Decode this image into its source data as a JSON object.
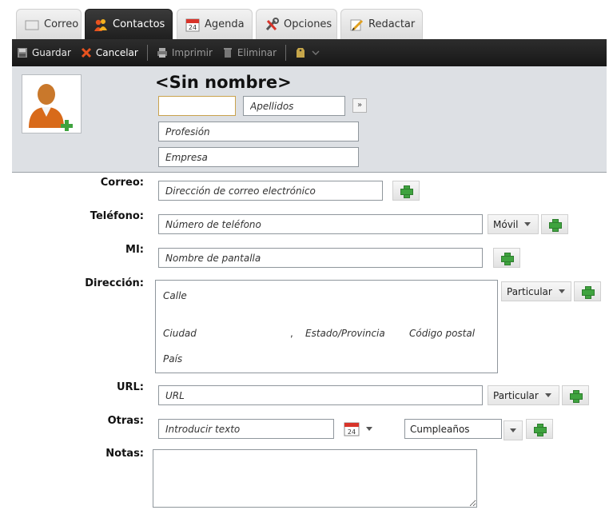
{
  "tabs": [
    {
      "label": "Correo",
      "icon": "mail-icon"
    },
    {
      "label": "Contactos",
      "icon": "contacts-icon"
    },
    {
      "label": "Agenda",
      "icon": "calendar-icon",
      "icon_text": "24"
    },
    {
      "label": "Opciones",
      "icon": "tools-icon"
    },
    {
      "label": "Redactar",
      "icon": "compose-icon"
    }
  ],
  "active_tab": "Contactos",
  "toolbar": {
    "save_label": "Guardar",
    "cancel_label": "Cancelar",
    "print_label": "Imprimir",
    "delete_label": "Eliminar"
  },
  "header": {
    "title": "<Sin nombre>",
    "first_name_value": "",
    "last_name_placeholder": "Apellidos",
    "expand_label": "»",
    "profession_placeholder": "Profesión",
    "company_placeholder": "Empresa"
  },
  "form": {
    "email": {
      "label": "Correo:",
      "placeholder": "Dirección de correo electrónico"
    },
    "phone": {
      "label": "Teléfono:",
      "placeholder": "Número de teléfono",
      "type": "Móvil"
    },
    "im": {
      "label": "MI:",
      "placeholder": "Nombre de pantalla"
    },
    "address": {
      "label": "Dirección:",
      "type": "Particular",
      "street": "Calle",
      "city": "Ciudad",
      "comma": ",",
      "state": "Estado/Provincia",
      "postal": "Código postal",
      "country": "País"
    },
    "url": {
      "label": "URL:",
      "placeholder": "URL",
      "type": "Particular"
    },
    "other": {
      "label": "Otras:",
      "placeholder": "Introducir texto",
      "calendar_day": "24",
      "type": "Cumpleaños"
    },
    "notes": {
      "label": "Notas:"
    }
  },
  "colors": {
    "toolbar_bg": "#1f1f1f",
    "header_bg": "#dde0e4",
    "plus_green": "#3fa33f",
    "active_tab": "#2a2a2a"
  }
}
